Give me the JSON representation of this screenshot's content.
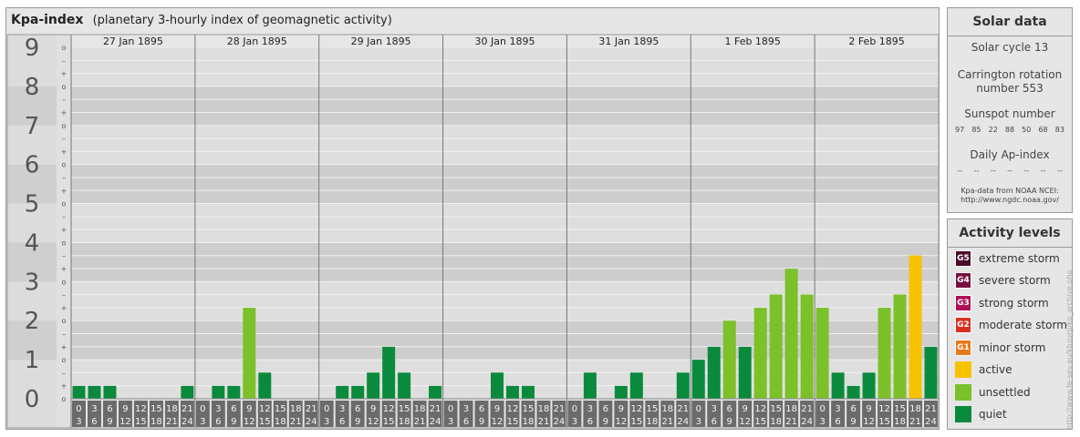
{
  "header": {
    "title": "Kpa-index",
    "subtitle": "(planetary 3-hourly index of geomagnetic activity)"
  },
  "chart_data": {
    "type": "bar",
    "title": "Kpa-index",
    "subtitle": "(planetary 3-hourly index of geomagnetic activity)",
    "ylim": [
      0,
      9
    ],
    "y_ticks": [
      "0",
      "1",
      "2",
      "3",
      "4",
      "5",
      "6",
      "7",
      "8",
      "9"
    ],
    "minor_ticks": [
      "o",
      "+",
      "–",
      "o",
      "+",
      "–",
      "o",
      "+",
      "–",
      "o",
      "+",
      "–",
      "o",
      "+",
      "–",
      "o",
      "+",
      "–",
      "o",
      "+",
      "–",
      "o",
      "+",
      "–",
      "o",
      "+",
      "–",
      "o"
    ],
    "days": [
      "27 Jan 1895",
      "28 Jan 1895",
      "29 Jan 1895",
      "30 Jan 1895",
      "31 Jan 1895",
      "1 Feb 1895",
      "2 Feb 1895"
    ],
    "interval_top": [
      "0",
      "3",
      "6",
      "9",
      "12",
      "15",
      "18",
      "21"
    ],
    "interval_bottom": [
      "3",
      "6",
      "9",
      "12",
      "15",
      "18",
      "21",
      "24"
    ],
    "values": [
      0.33,
      0.33,
      0.33,
      0,
      0,
      0,
      0,
      0.33,
      0,
      0.33,
      0.33,
      2.33,
      0.67,
      0,
      0,
      0,
      0,
      0.33,
      0.33,
      0.67,
      1.33,
      0.67,
      0,
      0.33,
      0,
      0,
      0,
      0.67,
      0.33,
      0.33,
      0,
      0,
      0,
      0.67,
      0,
      0.33,
      0.67,
      0,
      0,
      0.67,
      1,
      1.33,
      2,
      1.33,
      2.33,
      2.67,
      3.33,
      2.67,
      2.33,
      0.67,
      0.33,
      0.67,
      2.33,
      2.67,
      3.67,
      1.33
    ],
    "level_colors": {
      "quiet": "#0a8a3c",
      "unsettled": "#7cc02a",
      "active": "#f7c200"
    }
  },
  "solar": {
    "title": "Solar data",
    "cycle": "Solar cycle 13",
    "carrington_1": "Carrington rotation",
    "carrington_2": "number 553",
    "sunspot_label": "Sunspot number",
    "sunspots": [
      "97",
      "85",
      "22",
      "88",
      "50",
      "68",
      "83"
    ],
    "ap_label": "Daily Ap-index",
    "ap": [
      "--",
      "--",
      "--",
      "--",
      "--",
      "--",
      "--"
    ],
    "source_1": "Kpa-data from NOAA NCEI:",
    "source_2": "http://www.ngdc.noaa.gov/"
  },
  "activity": {
    "title": "Activity levels",
    "levels": [
      {
        "badge": "G5",
        "label": "extreme storm",
        "color": "#4a0a2a"
      },
      {
        "badge": "G4",
        "label": "severe storm",
        "color": "#7a1040"
      },
      {
        "badge": "G3",
        "label": "strong storm",
        "color": "#b0105a"
      },
      {
        "badge": "G2",
        "label": "moderate storm",
        "color": "#d83020"
      },
      {
        "badge": "G1",
        "label": "minor storm",
        "color": "#e87818"
      },
      {
        "badge": "",
        "label": "active",
        "color": "#f7c200"
      },
      {
        "badge": "",
        "label": "unsettled",
        "color": "#7cc02a"
      },
      {
        "badge": "",
        "label": "quiet",
        "color": "#0a8a3c"
      }
    ]
  },
  "credit": "http://www.fe-sev.eu/kbzurg/kp_archive.php"
}
